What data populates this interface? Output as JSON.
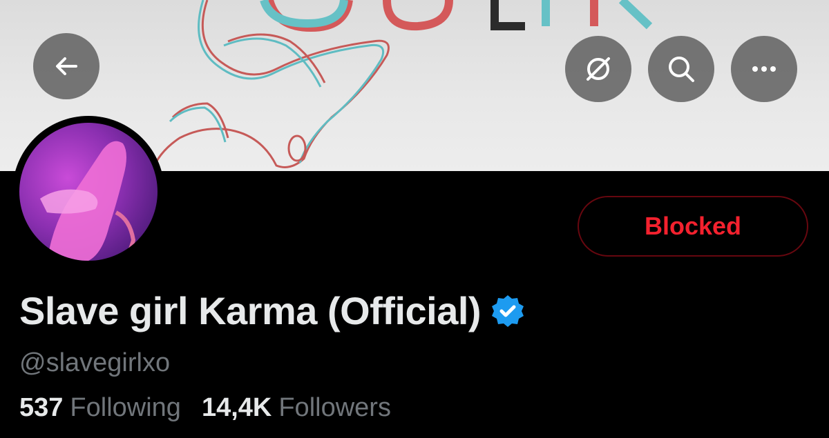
{
  "header": {
    "back_icon": "arrow-left-icon",
    "grok_icon": "slash-circle-icon",
    "search_icon": "search-icon",
    "more_icon": "more-horizontal-icon"
  },
  "profile": {
    "display_name": "Slave girl Karma (Official)",
    "handle": "@slavegirlxo",
    "verified": true,
    "action_button_label": "Blocked",
    "following_count": "537",
    "following_label": "Following",
    "followers_count": "14,4K",
    "followers_label": "Followers"
  },
  "colors": {
    "background": "#000000",
    "blocked_red": "#f4212e",
    "verified_blue": "#1d9bf0",
    "muted_text": "#71767b"
  }
}
